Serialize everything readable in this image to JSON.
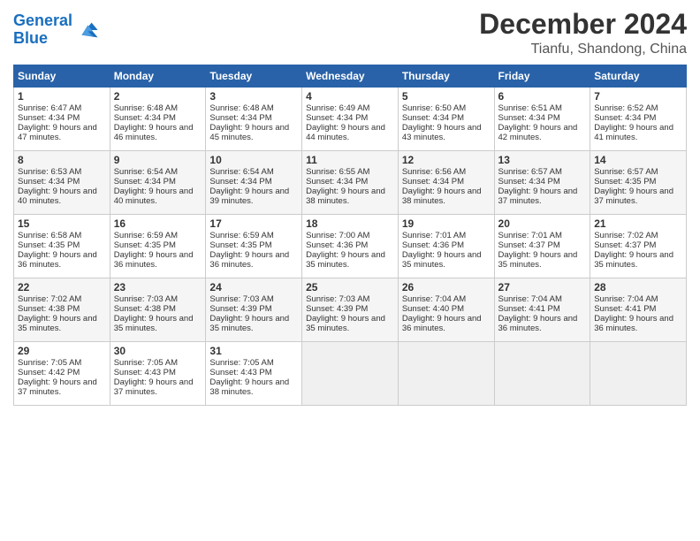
{
  "header": {
    "logo_line1": "General",
    "logo_line2": "Blue",
    "month": "December 2024",
    "location": "Tianfu, Shandong, China"
  },
  "columns": [
    "Sunday",
    "Monday",
    "Tuesday",
    "Wednesday",
    "Thursday",
    "Friday",
    "Saturday"
  ],
  "weeks": [
    [
      {
        "day": "1",
        "sunrise": "Sunrise: 6:47 AM",
        "sunset": "Sunset: 4:34 PM",
        "daylight": "Daylight: 9 hours and 47 minutes."
      },
      {
        "day": "2",
        "sunrise": "Sunrise: 6:48 AM",
        "sunset": "Sunset: 4:34 PM",
        "daylight": "Daylight: 9 hours and 46 minutes."
      },
      {
        "day": "3",
        "sunrise": "Sunrise: 6:48 AM",
        "sunset": "Sunset: 4:34 PM",
        "daylight": "Daylight: 9 hours and 45 minutes."
      },
      {
        "day": "4",
        "sunrise": "Sunrise: 6:49 AM",
        "sunset": "Sunset: 4:34 PM",
        "daylight": "Daylight: 9 hours and 44 minutes."
      },
      {
        "day": "5",
        "sunrise": "Sunrise: 6:50 AM",
        "sunset": "Sunset: 4:34 PM",
        "daylight": "Daylight: 9 hours and 43 minutes."
      },
      {
        "day": "6",
        "sunrise": "Sunrise: 6:51 AM",
        "sunset": "Sunset: 4:34 PM",
        "daylight": "Daylight: 9 hours and 42 minutes."
      },
      {
        "day": "7",
        "sunrise": "Sunrise: 6:52 AM",
        "sunset": "Sunset: 4:34 PM",
        "daylight": "Daylight: 9 hours and 41 minutes."
      }
    ],
    [
      {
        "day": "8",
        "sunrise": "Sunrise: 6:53 AM",
        "sunset": "Sunset: 4:34 PM",
        "daylight": "Daylight: 9 hours and 40 minutes."
      },
      {
        "day": "9",
        "sunrise": "Sunrise: 6:54 AM",
        "sunset": "Sunset: 4:34 PM",
        "daylight": "Daylight: 9 hours and 40 minutes."
      },
      {
        "day": "10",
        "sunrise": "Sunrise: 6:54 AM",
        "sunset": "Sunset: 4:34 PM",
        "daylight": "Daylight: 9 hours and 39 minutes."
      },
      {
        "day": "11",
        "sunrise": "Sunrise: 6:55 AM",
        "sunset": "Sunset: 4:34 PM",
        "daylight": "Daylight: 9 hours and 38 minutes."
      },
      {
        "day": "12",
        "sunrise": "Sunrise: 6:56 AM",
        "sunset": "Sunset: 4:34 PM",
        "daylight": "Daylight: 9 hours and 38 minutes."
      },
      {
        "day": "13",
        "sunrise": "Sunrise: 6:57 AM",
        "sunset": "Sunset: 4:34 PM",
        "daylight": "Daylight: 9 hours and 37 minutes."
      },
      {
        "day": "14",
        "sunrise": "Sunrise: 6:57 AM",
        "sunset": "Sunset: 4:35 PM",
        "daylight": "Daylight: 9 hours and 37 minutes."
      }
    ],
    [
      {
        "day": "15",
        "sunrise": "Sunrise: 6:58 AM",
        "sunset": "Sunset: 4:35 PM",
        "daylight": "Daylight: 9 hours and 36 minutes."
      },
      {
        "day": "16",
        "sunrise": "Sunrise: 6:59 AM",
        "sunset": "Sunset: 4:35 PM",
        "daylight": "Daylight: 9 hours and 36 minutes."
      },
      {
        "day": "17",
        "sunrise": "Sunrise: 6:59 AM",
        "sunset": "Sunset: 4:35 PM",
        "daylight": "Daylight: 9 hours and 36 minutes."
      },
      {
        "day": "18",
        "sunrise": "Sunrise: 7:00 AM",
        "sunset": "Sunset: 4:36 PM",
        "daylight": "Daylight: 9 hours and 35 minutes."
      },
      {
        "day": "19",
        "sunrise": "Sunrise: 7:01 AM",
        "sunset": "Sunset: 4:36 PM",
        "daylight": "Daylight: 9 hours and 35 minutes."
      },
      {
        "day": "20",
        "sunrise": "Sunrise: 7:01 AM",
        "sunset": "Sunset: 4:37 PM",
        "daylight": "Daylight: 9 hours and 35 minutes."
      },
      {
        "day": "21",
        "sunrise": "Sunrise: 7:02 AM",
        "sunset": "Sunset: 4:37 PM",
        "daylight": "Daylight: 9 hours and 35 minutes."
      }
    ],
    [
      {
        "day": "22",
        "sunrise": "Sunrise: 7:02 AM",
        "sunset": "Sunset: 4:38 PM",
        "daylight": "Daylight: 9 hours and 35 minutes."
      },
      {
        "day": "23",
        "sunrise": "Sunrise: 7:03 AM",
        "sunset": "Sunset: 4:38 PM",
        "daylight": "Daylight: 9 hours and 35 minutes."
      },
      {
        "day": "24",
        "sunrise": "Sunrise: 7:03 AM",
        "sunset": "Sunset: 4:39 PM",
        "daylight": "Daylight: 9 hours and 35 minutes."
      },
      {
        "day": "25",
        "sunrise": "Sunrise: 7:03 AM",
        "sunset": "Sunset: 4:39 PM",
        "daylight": "Daylight: 9 hours and 35 minutes."
      },
      {
        "day": "26",
        "sunrise": "Sunrise: 7:04 AM",
        "sunset": "Sunset: 4:40 PM",
        "daylight": "Daylight: 9 hours and 36 minutes."
      },
      {
        "day": "27",
        "sunrise": "Sunrise: 7:04 AM",
        "sunset": "Sunset: 4:41 PM",
        "daylight": "Daylight: 9 hours and 36 minutes."
      },
      {
        "day": "28",
        "sunrise": "Sunrise: 7:04 AM",
        "sunset": "Sunset: 4:41 PM",
        "daylight": "Daylight: 9 hours and 36 minutes."
      }
    ],
    [
      {
        "day": "29",
        "sunrise": "Sunrise: 7:05 AM",
        "sunset": "Sunset: 4:42 PM",
        "daylight": "Daylight: 9 hours and 37 minutes."
      },
      {
        "day": "30",
        "sunrise": "Sunrise: 7:05 AM",
        "sunset": "Sunset: 4:43 PM",
        "daylight": "Daylight: 9 hours and 37 minutes."
      },
      {
        "day": "31",
        "sunrise": "Sunrise: 7:05 AM",
        "sunset": "Sunset: 4:43 PM",
        "daylight": "Daylight: 9 hours and 38 minutes."
      },
      null,
      null,
      null,
      null
    ]
  ]
}
